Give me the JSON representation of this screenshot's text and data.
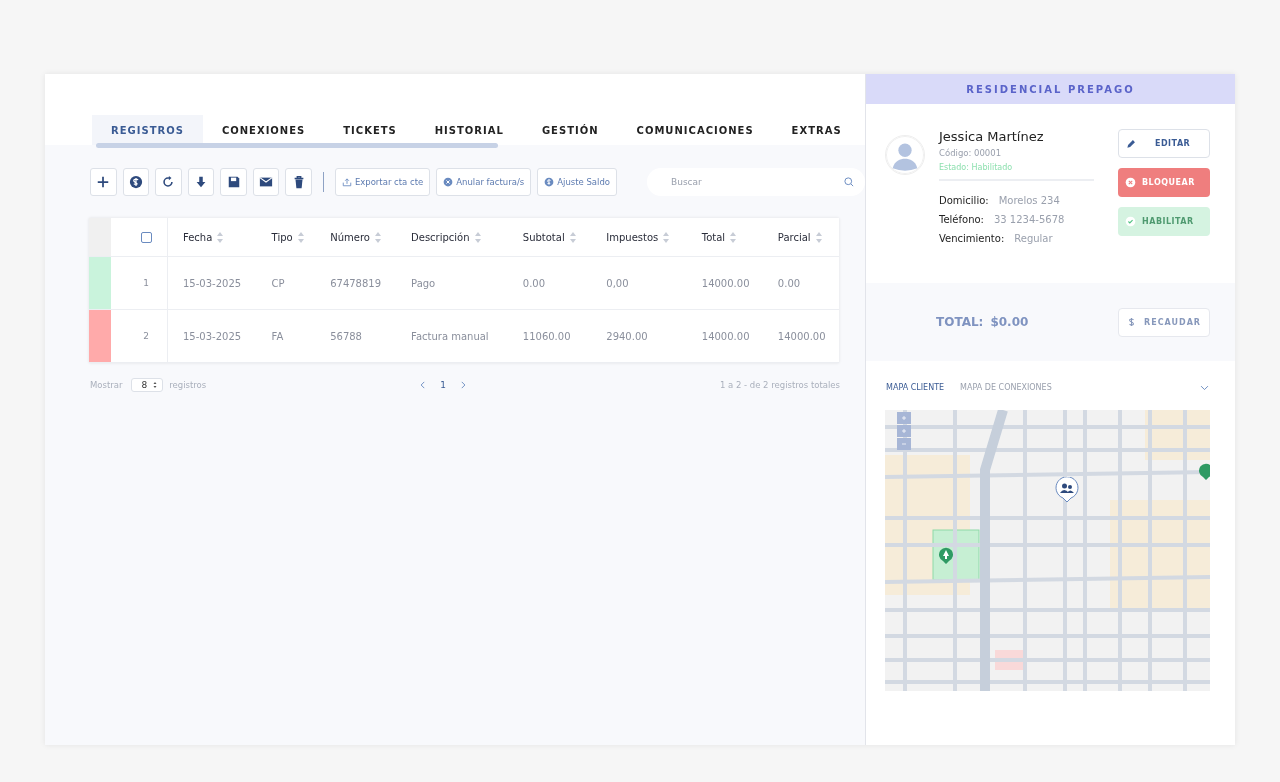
{
  "tabs": [
    {
      "label": "REGISTROS",
      "selected": true
    },
    {
      "label": "CONEXIONES",
      "selected": false
    },
    {
      "label": "TICKETS",
      "selected": false
    },
    {
      "label": "HISTORIAL",
      "selected": false
    },
    {
      "label": "GESTIÓN",
      "selected": false
    },
    {
      "label": "COMUNICACIONES",
      "selected": false
    },
    {
      "label": "EXTRAS",
      "selected": false
    }
  ],
  "toolbar": {
    "text_buttons": [
      "Exportar cta cte",
      "Anular factura/s",
      "Ajuste Saldo"
    ],
    "search": {
      "placeholder": "Buscar"
    }
  },
  "table": {
    "select_all_checked": false,
    "columns": [
      "Fecha",
      "Tipo",
      "Número",
      "Descripción",
      "Subtotal",
      "Impuestos",
      "Total",
      "Parcial"
    ],
    "rows": [
      {
        "color": "#c9f3dc",
        "index": "1",
        "cells": [
          "15-03-2025",
          "CP",
          "67478819",
          "Pago",
          "0.00",
          "0,00",
          "14000.00",
          "0.00"
        ]
      },
      {
        "color": "#ffaaaa",
        "index": "2",
        "cells": [
          "15-03-2025",
          "FA",
          "56788",
          "Factura manual",
          "11060.00",
          "2940.00",
          "14000.00",
          "14000.00"
        ]
      }
    ]
  },
  "pagination": {
    "show_label": "Mostrar",
    "page_size": "8",
    "records_label": "registros",
    "pages": [
      {
        "label": "1",
        "selected": true
      }
    ],
    "summary": "1 a 2 - de 2 registros totales"
  },
  "client": {
    "plan": "RESIDENCIAL PREPAGO",
    "name": "Jessica Martínez",
    "code": "Código: 00001",
    "status": "Estado: Habilitado",
    "fields": [
      {
        "label": "Domicilio:",
        "value": "Morelos 234"
      },
      {
        "label": "Teléfono:",
        "value": "33 1234-5678"
      },
      {
        "label": "Vencimiento:",
        "value": "Regular"
      }
    ],
    "actions": [
      {
        "kind": "edit",
        "label": "EDITAR",
        "disabled": false
      },
      {
        "kind": "block",
        "label": "BLOQUEAR",
        "disabled": false
      },
      {
        "kind": "enable",
        "label": "HABILITAR",
        "disabled": true
      }
    ],
    "total_label": "TOTAL:",
    "total_value": "$0.00",
    "collect": {
      "label": "RECAUDAR",
      "disabled": true
    }
  },
  "map": {
    "tabs": [
      {
        "label": "MAPA CLIENTE",
        "selected": true
      },
      {
        "label": "MAPA DE CONEXIONES",
        "selected": false
      }
    ]
  }
}
